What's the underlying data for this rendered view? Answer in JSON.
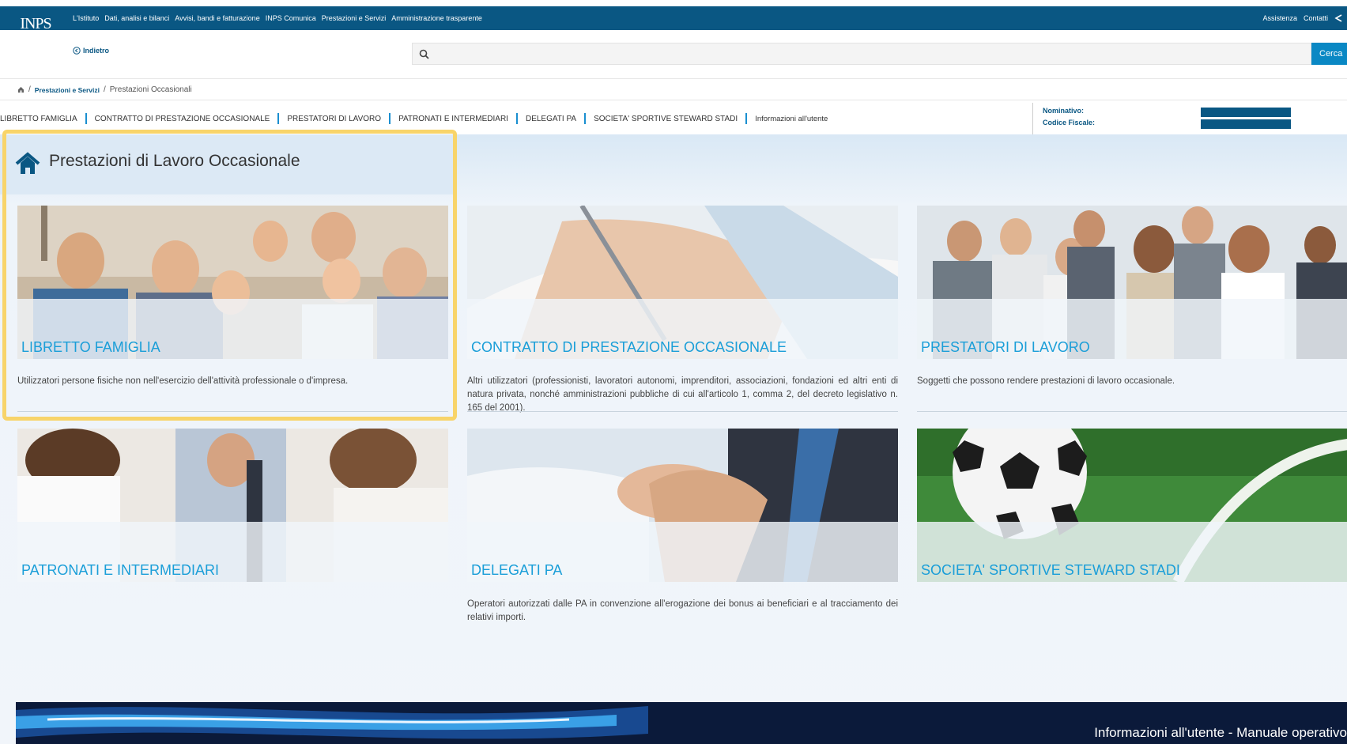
{
  "top_nav": {
    "items": [
      "L'Istituto",
      "Dati, analisi e bilanci",
      "Avvisi, bandi e fatturazione",
      "INPS Comunica",
      "Prestazioni e Servizi",
      "Amministrazione trasparente"
    ],
    "right": [
      "Assistenza",
      "Contatti"
    ]
  },
  "logo": {
    "text": "INPS"
  },
  "header": {
    "back_label": "Indietro",
    "search_placeholder": "",
    "search_button": "Cerca"
  },
  "breadcrumb": {
    "items": [
      "Prestazioni e Servizi",
      "Prestazioni Occasionali"
    ]
  },
  "section_nav": {
    "items": [
      "LIBRETTO FAMIGLIA",
      "CONTRATTO DI PRESTAZIONE OCCASIONALE",
      "PRESTATORI DI LAVORO",
      "PATRONATI E INTERMEDIARI",
      "DELEGATI PA",
      "SOCIETA' SPORTIVE STEWARD STADI",
      "Informazioni all'utente"
    ]
  },
  "user": {
    "nominativo_label": "Nominativo:",
    "codice_fiscale_label": "Codice Fiscale:"
  },
  "page": {
    "title": "Prestazioni di Lavoro Occasionale"
  },
  "cards": [
    {
      "title": "LIBRETTO FAMIGLIA",
      "desc": "Utilizzatori persone fisiche non nell'esercizio dell'attività professionale o d'impresa."
    },
    {
      "title": "CONTRATTO DI PRESTAZIONE OCCASIONALE",
      "desc": "Altri utilizzatori (professionisti, lavoratori autonomi, imprenditori, associazioni, fondazioni ed altri enti di natura privata, nonché amministrazioni pubbliche di cui all'articolo 1, comma 2, del decreto legislativo n. 165 del 2001)."
    },
    {
      "title": "PRESTATORI DI LAVORO",
      "desc": "Soggetti che possono rendere prestazioni di lavoro occasionale."
    },
    {
      "title": "PATRONATI E INTERMEDIARI",
      "desc": ""
    },
    {
      "title": "DELEGATI PA",
      "desc": "Operatori autorizzati dalle PA in convenzione all'erogazione dei bonus ai beneficiari e al tracciamento dei relativi importi."
    },
    {
      "title": "SOCIETA' SPORTIVE STEWARD STADI",
      "desc": ""
    }
  ],
  "footer": {
    "text": "Informazioni all'utente - Manuale operativo"
  },
  "colors": {
    "brand": "#0a5783",
    "accent": "#1a9ed8",
    "highlight": "#f8d46a"
  }
}
